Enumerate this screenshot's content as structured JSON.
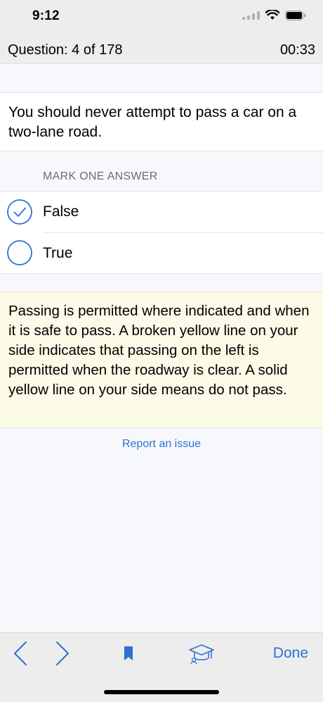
{
  "status_bar": {
    "time": "9:12"
  },
  "header": {
    "question_counter": "Question: 4 of 178",
    "timer": "00:33"
  },
  "question": {
    "text": "You should never attempt to pass a car on a two-lane road."
  },
  "answers": {
    "heading": "MARK ONE ANSWER",
    "options": [
      {
        "label": "False",
        "selected": true
      },
      {
        "label": "True",
        "selected": false
      }
    ]
  },
  "explanation": {
    "text": "Passing is permitted where indicated and when it is safe to pass. A broken yellow line on your side indicates that passing on the left is permitted when the roadway is clear. A solid yellow line on your side means do not pass."
  },
  "report_link": "Report an issue",
  "toolbar": {
    "done_label": "Done",
    "icons": [
      "chevron-left-icon",
      "chevron-right-icon",
      "bookmark-icon",
      "graduation-cap-icon"
    ]
  },
  "colors": {
    "accent": "#2f6fd6",
    "explanation_bg": "#fbfbe7",
    "bar_bg": "#ededed"
  }
}
